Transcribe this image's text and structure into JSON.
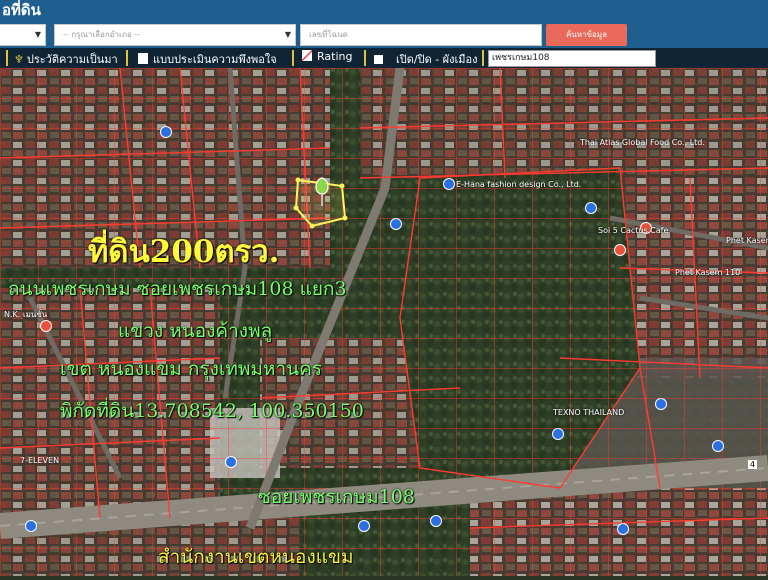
{
  "header": {
    "title": "อที่ดิน",
    "district_placeholder": "-- กรุณาเลือกอำเภอ --",
    "parcel_placeholder": "เลขที่โฉนด",
    "search_label": "ค้นหาข้อมูล",
    "bg_color": "#1f5f8f",
    "button_color": "#e96a5a"
  },
  "toolbar": {
    "history_label": "ประวัติความเป็นมา",
    "assess_label": "แบบประเมินความพึงพอใจ",
    "rating_label": "Rating",
    "toggle_label": "เปิด/ปิด - ผังเมือง",
    "search_value": "เพชรเกษม108"
  },
  "overlay": {
    "headline": "ที่ดิน200ตรว.",
    "line1": "ถนนเพชรเกษม ซอยเพชรเกษม108 แยก3",
    "line2": "แขวง หนองค้างพลู",
    "line3": "เขต หนองแขม กรุงเทพมหานคร",
    "line4": "พิกัดที่ดิน13.708542, 100.350150",
    "soi_label": "ซอยเพชรเกษม108",
    "office_label": "สำนักงานเขตหนองแขม"
  },
  "map_labels": {
    "thai_atlas": "Thai Atlas Global Food Co., Ltd.",
    "e_hana": "E-Hana fashion design Co., Ltd.",
    "soi5": "Soi 5 Cactus Cafe",
    "phet_kasem_110": "Phet Kasem 110",
    "phet_kasem": "Phet Kasem",
    "texno": "TEXNO THAILAND",
    "seven_eleven": "7-ELEVEN",
    "nk": "N.K. เมนชั่น",
    "road_num": "4"
  },
  "colors": {
    "parcel_line": "#ff3b30",
    "highlight": "#fff35a",
    "marker": "#8cd64a"
  }
}
